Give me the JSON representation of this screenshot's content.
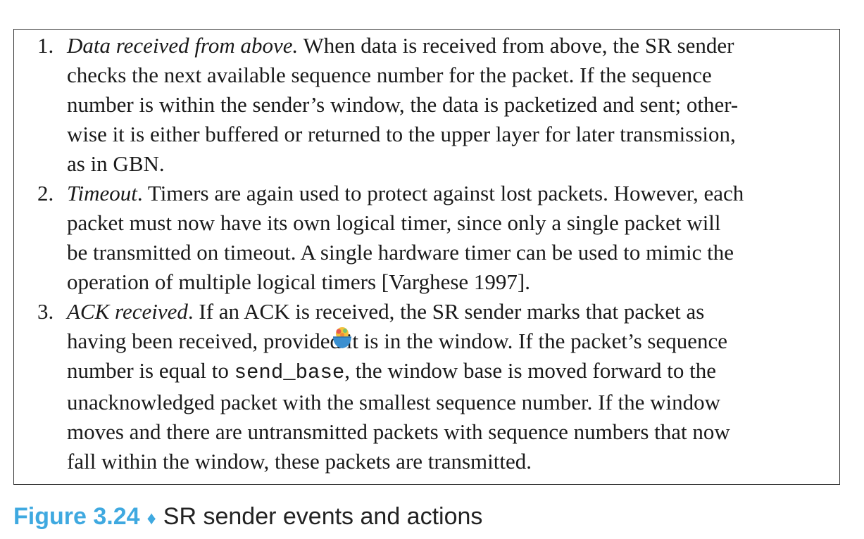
{
  "items": [
    {
      "number": "1.",
      "term": "Data received from above.",
      "line1_rest": " When data is received from above, the SR sender",
      "line2": "checks the next available sequence number for the packet. If the sequence",
      "line3": "number is within the sender’s window, the data is packetized and sent; other-",
      "line4": "wise it is either buffered or returned to the upper layer for later transmission,",
      "line5": "as in GBN."
    },
    {
      "number": "2.",
      "term": "Timeout",
      "line1_rest": ". Timers are again used to protect against lost packets. However, each",
      "line2": "packet must now have its own logical timer, since only a single packet will",
      "line3": "be transmitted on timeout. A single hardware timer can be used to mimic the",
      "line4": "operation of multiple logical timers [Varghese 1997]."
    },
    {
      "number": "3.",
      "term": "ACK received",
      "line1_rest": ". If an ACK is received, the SR sender marks that packet as",
      "line2": "having been received, provided it is in the window. If the packet’s sequence",
      "line3_pre": "number is equal to ",
      "line3_code": "send_base",
      "line3_post": ", the window base is moved forward to the",
      "line4": "unacknowledged packet with the smallest sequence number. If the window",
      "line5": "moves and there are untransmitted packets with sequence numbers that now",
      "line6": "fall within the window, these packets are transmitted."
    }
  ],
  "caption": {
    "label": "Figure 3.24",
    "separator": "♦",
    "title": "SR sender events and actions",
    "label_color": "#3fa9e0",
    "separator_color": "#3fa9e0"
  },
  "overlay_icon": "bowl-emoji-icon"
}
